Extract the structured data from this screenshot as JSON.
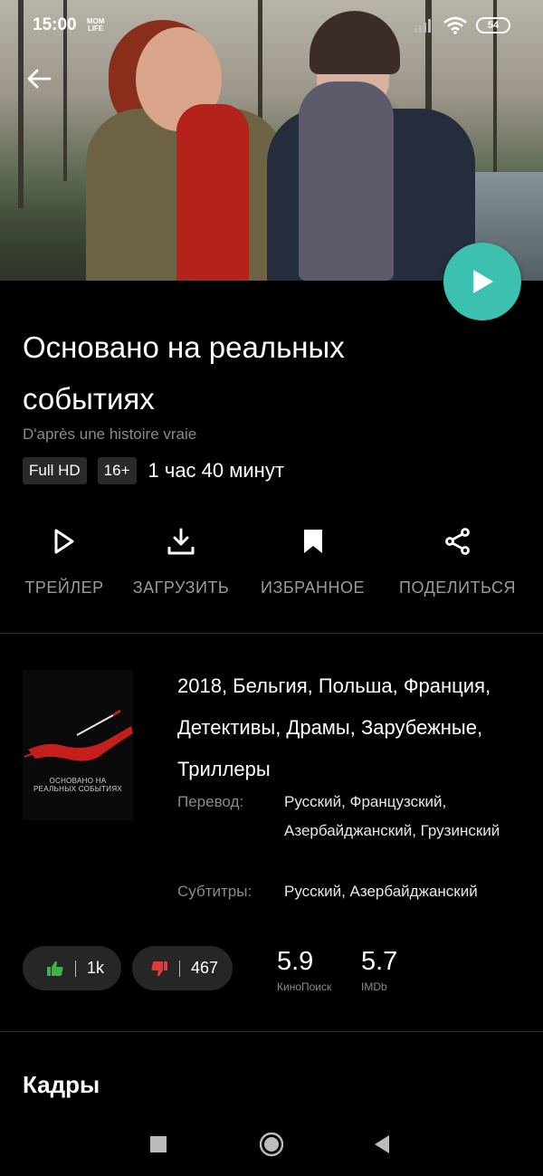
{
  "status_bar": {
    "time": "15:00",
    "app_badge_line1": "MOM",
    "app_badge_line2": "LIFE",
    "battery": "54"
  },
  "movie": {
    "title": "Основано на реальных событиях",
    "original_title": "D'après une histoire vraie",
    "quality_badge": "Full HD",
    "age_badge": "16+",
    "duration": "1 час 40 минут"
  },
  "actions": [
    {
      "label": "ТРЕЙЛЕР",
      "icon": "play-outline-icon"
    },
    {
      "label": "ЗАГРУЗИТЬ",
      "icon": "download-icon"
    },
    {
      "label": "ИЗБРАННОЕ",
      "icon": "bookmark-icon"
    },
    {
      "label": "ПОДЕЛИТЬСЯ",
      "icon": "share-icon"
    }
  ],
  "poster": {
    "caption_line1": "ОСНОВАНО НА",
    "caption_line2": "РЕАЛЬНЫХ СОБЫТИЯХ"
  },
  "details": {
    "genres": "2018, Бельгия, Польша, Франция, Детективы, Драмы, Зарубежные, Триллеры",
    "translation_label": "Перевод:",
    "translation_value": "Русский, Французский, Азербайджанский, Грузинский",
    "subtitles_label": "Субтитры:",
    "subtitles_value": "Русский, Азербайджанский"
  },
  "votes": {
    "likes": "1k",
    "dislikes": "467",
    "like_color": "#3bb54a",
    "dislike_color": "#e03a3a"
  },
  "ratings": [
    {
      "value": "5.9",
      "source": "КиноПоиск"
    },
    {
      "value": "5.7",
      "source": "IMDb"
    }
  ],
  "sections": {
    "frames_title": "Кадры"
  },
  "colors": {
    "accent": "#3cc1b0",
    "background": "#000000",
    "muted_text": "#8a8a8a"
  }
}
